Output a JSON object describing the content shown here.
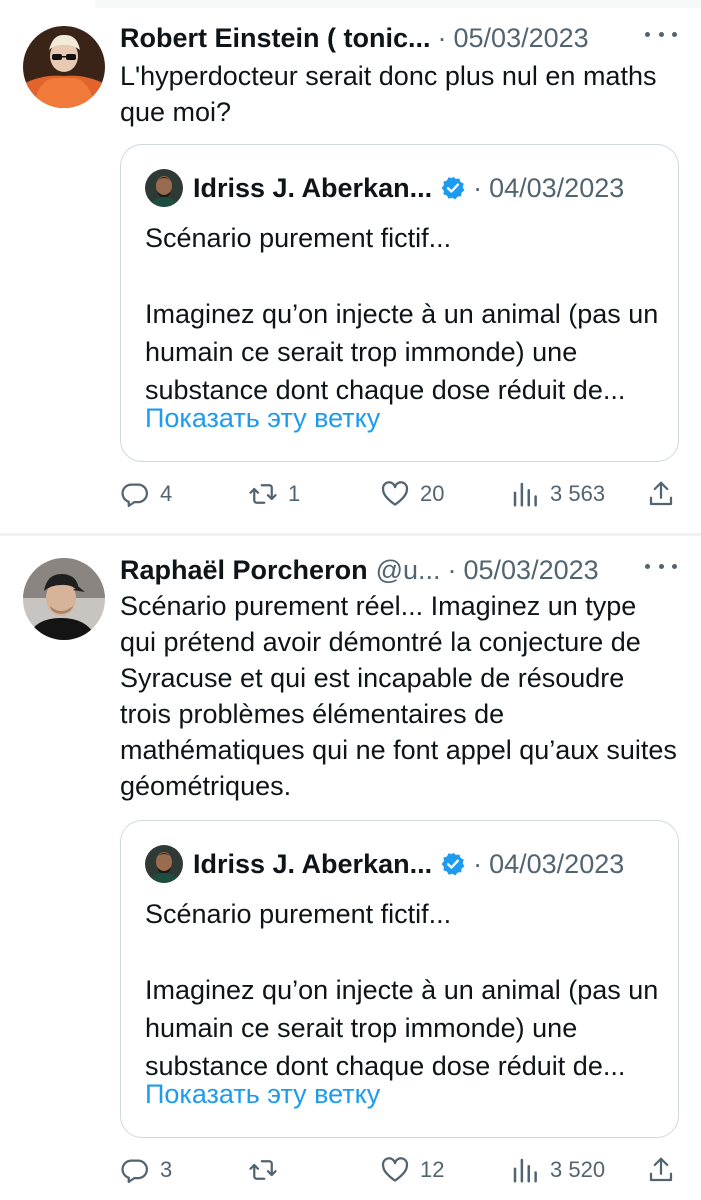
{
  "tweets": [
    {
      "author_name": "Robert Einstein ( tonic...",
      "handle": "",
      "date": "05/03/2023",
      "text": "L'hyperdocteur serait donc plus nul en maths que moi?",
      "quote": {
        "author_name": "Idriss J. Aberkan...",
        "date": "04/03/2023",
        "line1": "Scénario purement fictif...",
        "line2": "Imaginez qu’on injecte à un animal (pas un humain ce serait trop immonde) une substance dont chaque dose réduit de...",
        "show_thread": "Показать эту ветку"
      },
      "replies": "4",
      "retweets": "1",
      "likes": "20",
      "views": "3 563"
    },
    {
      "author_name": "Raphaël Porcheron",
      "handle": "@u...",
      "date": "05/03/2023",
      "text": "Scénario purement réel... Imaginez un type qui prétend avoir démontré la conjecture de Syracuse et qui est incapable de résoudre trois problèmes élémentaires de mathématiques qui ne font appel qu’aux suites géométriques.",
      "quote": {
        "author_name": "Idriss J. Aberkan...",
        "date": "04/03/2023",
        "line1": "Scénario purement fictif...",
        "line2": "Imaginez qu’on injecte à un animal (pas un humain ce serait trop immonde) une substance dont chaque dose réduit de...",
        "show_thread": "Показать эту ветку"
      },
      "replies": "3",
      "retweets": "",
      "likes": "12",
      "views": "3 520"
    }
  ],
  "separator_middle_dot": "·",
  "colors": {
    "text": "#0f1419",
    "secondary": "#536471",
    "link": "#1d9bf0",
    "border": "#cfd9de",
    "verified": "#1d9bf0"
  },
  "icons": [
    "reply-icon",
    "retweet-icon",
    "like-icon",
    "views-icon",
    "share-icon",
    "more-icon",
    "verified-badge-icon"
  ]
}
